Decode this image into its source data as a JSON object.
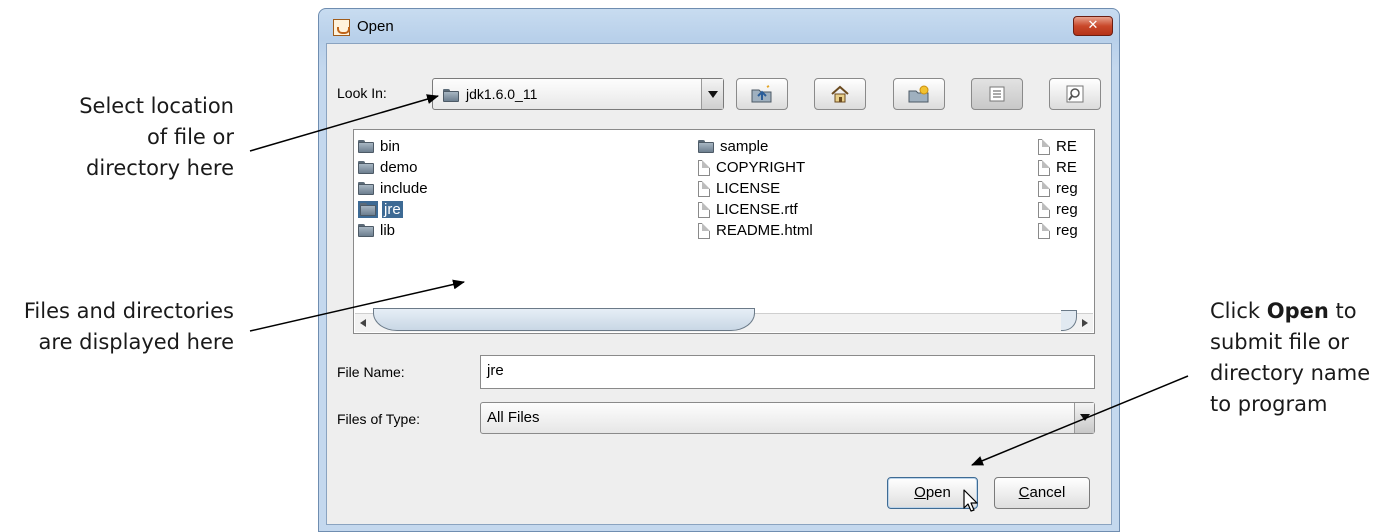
{
  "callouts": {
    "select_location": [
      "Select location",
      "of file or",
      "directory here"
    ],
    "files_displayed": [
      "Files and directories",
      "are displayed here"
    ],
    "click_open": {
      "line1_prefix": "Click ",
      "line1_bold": "Open",
      "line1_suffix": " to",
      "line2": "submit file or",
      "line3": "directory name",
      "line4": "to program"
    }
  },
  "window": {
    "title": "Open",
    "close_glyph": "✕"
  },
  "look_in": {
    "label": "Look In:",
    "value": "jdk1.6.0_11",
    "icon": "folder-icon"
  },
  "toolbar": {
    "buttons": [
      {
        "name": "up-one-level-button",
        "icon": "folder-up-icon"
      },
      {
        "name": "home-button",
        "icon": "home-icon"
      },
      {
        "name": "new-folder-button",
        "icon": "new-folder-icon"
      },
      {
        "name": "list-view-button",
        "icon": "list-icon",
        "active": true
      },
      {
        "name": "details-view-button",
        "icon": "details-icon"
      }
    ]
  },
  "files": {
    "column1": [
      {
        "name": "bin",
        "type": "folder"
      },
      {
        "name": "demo",
        "type": "folder"
      },
      {
        "name": "include",
        "type": "folder"
      },
      {
        "name": "jre",
        "type": "folder",
        "selected": true
      },
      {
        "name": "lib",
        "type": "folder"
      }
    ],
    "column2": [
      {
        "name": "sample",
        "type": "folder"
      },
      {
        "name": "COPYRIGHT",
        "type": "file"
      },
      {
        "name": "LICENSE",
        "type": "file"
      },
      {
        "name": "LICENSE.rtf",
        "type": "file"
      },
      {
        "name": "README.html",
        "type": "file"
      }
    ],
    "column3": [
      {
        "name": "RE",
        "type": "file"
      },
      {
        "name": "RE",
        "type": "file"
      },
      {
        "name": "reg",
        "type": "file"
      },
      {
        "name": "reg",
        "type": "file"
      },
      {
        "name": "reg",
        "type": "file"
      }
    ]
  },
  "file_name": {
    "label": "File Name:",
    "value": "jre"
  },
  "files_of_type": {
    "label": "Files of Type:",
    "value": "All Files"
  },
  "buttons": {
    "open_mnemonic": "O",
    "open_rest": "pen",
    "cancel_mnemonic": "C",
    "cancel_rest": "ancel"
  }
}
